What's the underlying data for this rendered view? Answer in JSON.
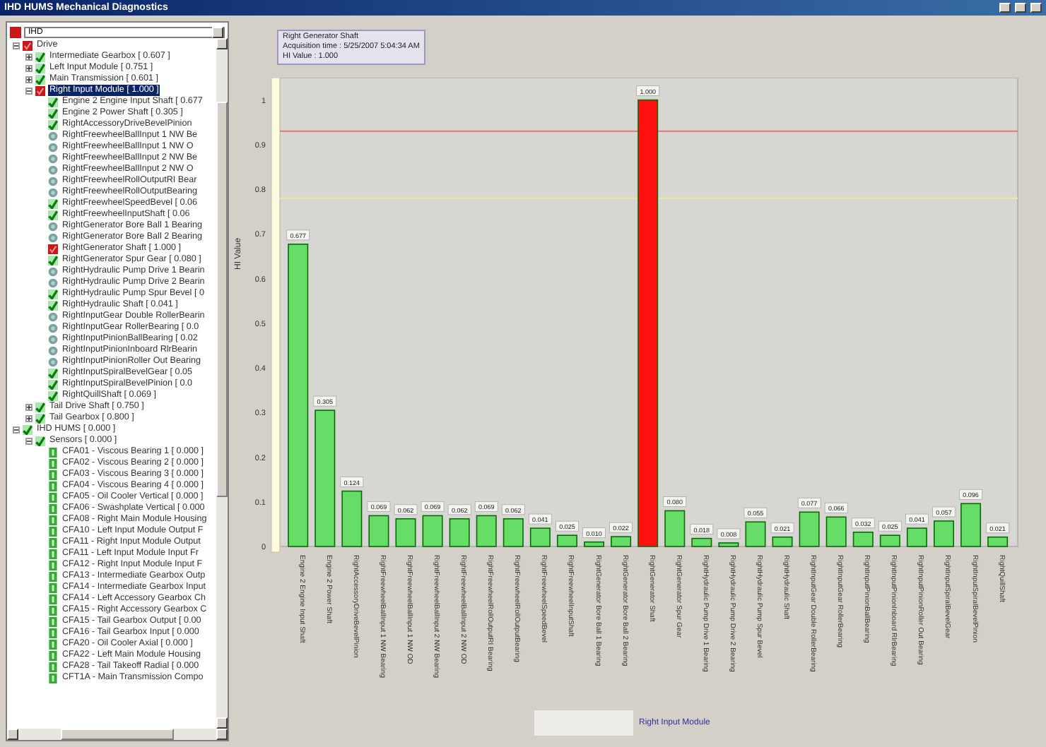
{
  "window": {
    "title": "IHD HUMS Mechanical Diagnostics"
  },
  "selector": {
    "value": "IHD"
  },
  "tree": [
    {
      "label": "Drive",
      "kind": "alarm",
      "expanded": true,
      "selected": false,
      "children": [
        {
          "label": "Intermediate Gearbox [ 0.607 ]",
          "kind": "ok",
          "expanded": false,
          "selected": false
        },
        {
          "label": "Left Input Module [ 0.751 ]",
          "kind": "ok",
          "expanded": false,
          "selected": false
        },
        {
          "label": "Main Transmission [ 0.601 ]",
          "kind": "ok",
          "expanded": false,
          "selected": false
        },
        {
          "label": "Right Input Module [ 1.000 ]",
          "kind": "alarm",
          "expanded": true,
          "selected": true,
          "children": [
            {
              "label": "Engine 2 Engine Input Shaft [ 0.677",
              "kind": "ok",
              "selected": false
            },
            {
              "label": "Engine 2 Power Shaft [ 0.305 ]",
              "kind": "ok",
              "selected": false
            },
            {
              "label": "RightAccessoryDriveBevelPinion",
              "kind": "ok",
              "selected": false
            },
            {
              "label": "RightFreewheelBallInput 1 NW Be",
              "kind": "na",
              "selected": false
            },
            {
              "label": "RightFreewheelBallInput 1 NW O",
              "kind": "na",
              "selected": false
            },
            {
              "label": "RightFreewheelBallInput 2 NW Be",
              "kind": "na",
              "selected": false
            },
            {
              "label": "RightFreewheelBallInput 2 NW O",
              "kind": "na",
              "selected": false
            },
            {
              "label": "RightFreewheelRollOutputRI Bear",
              "kind": "na",
              "selected": false
            },
            {
              "label": "RightFreewheelRollOutputBearing",
              "kind": "na",
              "selected": false
            },
            {
              "label": "RightFreewheelSpeedBevel [ 0.06",
              "kind": "ok",
              "selected": false
            },
            {
              "label": "RightFreewheelInputShaft [ 0.06",
              "kind": "ok",
              "selected": false
            },
            {
              "label": "RightGenerator Bore Ball 1 Bearing",
              "kind": "na",
              "selected": false
            },
            {
              "label": "RightGenerator Bore Ball 2 Bearing",
              "kind": "na",
              "selected": false
            },
            {
              "label": "RightGenerator Shaft [ 1.000 ]",
              "kind": "alarm",
              "selected": false
            },
            {
              "label": "RightGenerator Spur Gear [ 0.080 ]",
              "kind": "ok",
              "selected": false
            },
            {
              "label": "RightHydraulic Pump Drive 1 Bearin",
              "kind": "na",
              "selected": false
            },
            {
              "label": "RightHydraulic Pump Drive 2 Bearin",
              "kind": "na",
              "selected": false
            },
            {
              "label": "RightHydraulic Pump Spur Bevel [ 0",
              "kind": "ok",
              "selected": false
            },
            {
              "label": "RightHydraulic Shaft [ 0.041 ]",
              "kind": "ok",
              "selected": false
            },
            {
              "label": "RightInputGear Double RollerBearin",
              "kind": "na",
              "selected": false
            },
            {
              "label": "RightInputGear RollerBearing [ 0.0",
              "kind": "na",
              "selected": false
            },
            {
              "label": "RightInputPinionBallBearing [ 0.02",
              "kind": "na",
              "selected": false
            },
            {
              "label": "RightInputPinionInboard RlrBearin",
              "kind": "na",
              "selected": false
            },
            {
              "label": "RightInputPinionRoller Out Bearing",
              "kind": "na",
              "selected": false
            },
            {
              "label": "RightInputSpiralBevelGear [ 0.05",
              "kind": "ok",
              "selected": false
            },
            {
              "label": "RightInputSpiralBevelPinion [ 0.0",
              "kind": "ok",
              "selected": false
            },
            {
              "label": "RightQuillShaft [ 0.069 ]",
              "kind": "ok",
              "selected": false
            }
          ]
        },
        {
          "label": "Tail Drive Shaft [ 0.750 ]",
          "kind": "ok",
          "expanded": false,
          "selected": false
        },
        {
          "label": "Tail Gearbox [ 0.800 ]",
          "kind": "ok",
          "expanded": false,
          "selected": false
        }
      ]
    },
    {
      "label": "IHD HUMS [ 0.000 ]",
      "kind": "ok",
      "expanded": true,
      "selected": false,
      "children": [
        {
          "label": "Sensors [ 0.000 ]",
          "kind": "ok",
          "expanded": true,
          "selected": false,
          "children": [
            {
              "label": "CFA01 - Viscous Bearing 1 [ 0.000 ]",
              "kind": "sensor",
              "selected": false
            },
            {
              "label": "CFA02 - Viscous Bearing 2 [ 0.000 ]",
              "kind": "sensor",
              "selected": false
            },
            {
              "label": "CFA03 - Viscous Bearing 3 [ 0.000 ]",
              "kind": "sensor",
              "selected": false
            },
            {
              "label": "CFA04 - Viscous Bearing 4 [ 0.000 ]",
              "kind": "sensor",
              "selected": false
            },
            {
              "label": "CFA05 - Oil Cooler Vertical [ 0.000 ]",
              "kind": "sensor",
              "selected": false
            },
            {
              "label": "CFA06 - Swashplate Vertical [ 0.000",
              "kind": "sensor",
              "selected": false
            },
            {
              "label": "CFA08 - Right Main Module Housing",
              "kind": "sensor",
              "selected": false
            },
            {
              "label": "CFA10 - Left Input Module Output F",
              "kind": "sensor",
              "selected": false
            },
            {
              "label": "CFA11 - Right Input Module Output",
              "kind": "sensor",
              "selected": false
            },
            {
              "label": "CFA11 - Left Input Module Input Fr",
              "kind": "sensor",
              "selected": false
            },
            {
              "label": "CFA12 - Right Input Module Input F",
              "kind": "sensor",
              "selected": false
            },
            {
              "label": "CFA13 - Intermediate Gearbox Outp",
              "kind": "sensor",
              "selected": false
            },
            {
              "label": "CFA14 - Intermediate Gearbox Input",
              "kind": "sensor",
              "selected": false
            },
            {
              "label": "CFA14 - Left Accessory Gearbox Ch",
              "kind": "sensor",
              "selected": false
            },
            {
              "label": "CFA15 - Right Accessory Gearbox C",
              "kind": "sensor",
              "selected": false
            },
            {
              "label": "CFA15 - Tail Gearbox Output [ 0.00",
              "kind": "sensor",
              "selected": false
            },
            {
              "label": "CFA16 - Tail Gearbox Input [ 0.000",
              "kind": "sensor",
              "selected": false
            },
            {
              "label": "CFA20 - Oil Cooler Axial [ 0.000 ]",
              "kind": "sensor",
              "selected": false
            },
            {
              "label": "CFA22 - Left Main Module Housing",
              "kind": "sensor",
              "selected": false
            },
            {
              "label": "CFA28 - Tail Takeoff Radial [ 0.000",
              "kind": "sensor",
              "selected": false
            },
            {
              "label": "CFT1A - Main Transmission Compo",
              "kind": "sensor",
              "selected": false
            }
          ]
        }
      ]
    }
  ],
  "tooltip": {
    "lines": [
      "Right Generator Shaft",
      "Acquisition time : 5/25/2007 5:04:34 AM",
      "HI Value : 1.000"
    ]
  },
  "chart_data": {
    "type": "bar",
    "ylabel": "HI Value",
    "ylim": [
      0,
      1.05
    ],
    "yticks": [
      0,
      0.1,
      0.2,
      0.3,
      0.4,
      0.5,
      0.6,
      0.7,
      0.8,
      0.9,
      1
    ],
    "stacked": true,
    "value_labels": [
      "0.677",
      "0.305",
      "0.124",
      "0.069",
      "0.062",
      "0.069",
      "0.062",
      "0.069",
      "0.062",
      "0.041",
      "0.025",
      "0.010",
      "0.022",
      "1.000",
      "0.080",
      "0.018",
      "0.008",
      "0.055",
      "0.021",
      "0.077",
      "0.066",
      "0.032",
      "0.025",
      "0.041",
      "0.057",
      "0.096",
      "0.021"
    ],
    "categories": [
      "Engine 2 Engine Input Shaft",
      "Engine 2 Power Shaft",
      "RightAccessoryDriveBevelPinion",
      "RightFreewheelBallInput 1 NW Bearing",
      "RightFreewheelBallInput 1 NW OD",
      "RightFreewheelBallInput 2 NW Bearing",
      "RightFreewheelBallInput 2 NW OD",
      "RightFreewheelRollOutputRI Bearing",
      "RightFreewheelRollOutputBearing",
      "RightFreewheelSpeedBevel",
      "RightFreewheelInputShaft",
      "RightGenerator Bore Ball 1 Bearing",
      "RightGenerator Bore Ball 2 Bearing",
      "RightGenerator Shaft",
      "RightGenerator Spur Gear",
      "RightHydraulic Pump Drive 1 Bearing",
      "RightHydraulic Pump Drive 2 Bearing",
      "RightHydraulic Pump Spur Bevel",
      "RightHydraulic Shaft",
      "RightInputGear Double RollerBearing",
      "RightInputGear RollerBearing",
      "RightInputPinionBallBearing",
      "RightInputPinionInboard RlrBearing",
      "RightInputPinionRoller Out Bearing",
      "RightInputSpiralBevelGear",
      "RightInputSpiralBevelPinion",
      "RightQuillShaft"
    ],
    "series": [
      {
        "name": "Right Input Module",
        "color": "#66dd66",
        "values": [
          0.677,
          0.305,
          0.124,
          0.069,
          0.062,
          0.069,
          0.062,
          0.069,
          0.062,
          0.041,
          0.025,
          0.01,
          0.022,
          null,
          0.08,
          0.018,
          0.008,
          0.055,
          0.021,
          0.077,
          0.066,
          0.032,
          0.025,
          0.041,
          0.057,
          0.096,
          0.021
        ]
      },
      {
        "color": "#ff1010",
        "values": [
          null,
          null,
          null,
          null,
          null,
          null,
          null,
          null,
          null,
          null,
          null,
          null,
          null,
          1.0,
          null,
          null,
          null,
          null,
          null,
          null,
          null,
          null,
          null,
          null,
          null,
          null,
          null
        ]
      }
    ],
    "ref_lines": [
      {
        "axis": "y",
        "value": 0.93,
        "color": "#e08080"
      },
      {
        "axis": "y",
        "value": 0.78,
        "color": "#e8e6a0"
      }
    ]
  }
}
